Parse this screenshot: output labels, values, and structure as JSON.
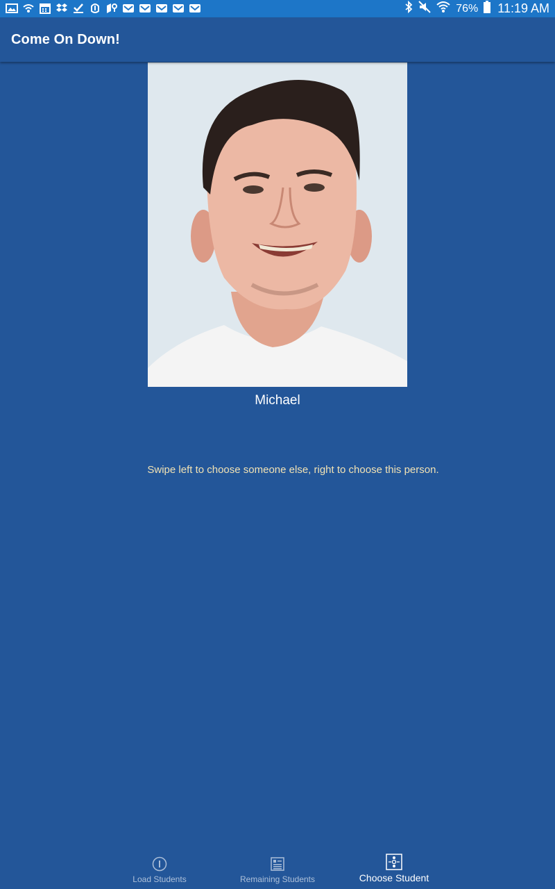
{
  "status_bar": {
    "left_icons": [
      "image-icon",
      "wifi-hotspot-icon",
      "calendar-icon",
      "dropbox-icon",
      "check-icon",
      "fingerprint-icon",
      "location-icon",
      "gmail-icon",
      "gmail-icon",
      "gmail-icon",
      "gmail-icon",
      "gmail-icon"
    ],
    "right_icons": [
      "bluetooth-icon",
      "mute-icon",
      "wifi-icon",
      "battery-icon"
    ],
    "battery": "76%",
    "time": "11:19 AM",
    "background_color": "#1d76c8"
  },
  "app_bar": {
    "title": "Come On Down!",
    "background_color": "#235699"
  },
  "student": {
    "name": "Michael"
  },
  "instruction": "Swipe left to choose someone else, right to choose this person.",
  "bottom_nav": {
    "items": [
      {
        "label": "Load Students",
        "icon": "info-icon",
        "active": false
      },
      {
        "label": "Remaining Students",
        "icon": "list-icon",
        "active": false
      },
      {
        "label": "Choose Student",
        "icon": "choose-student-icon",
        "active": true
      }
    ]
  },
  "colors": {
    "background": "#235699",
    "instruction_text": "#f1e2b4"
  }
}
